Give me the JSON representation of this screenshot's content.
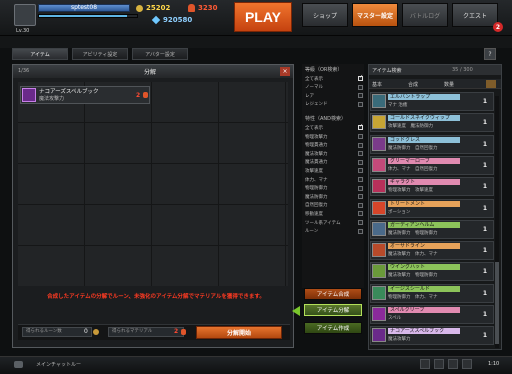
{
  "header": {
    "username": "sptest08",
    "level": "Lv.30",
    "gold": "25202",
    "fire": "3230",
    "gems": "920580",
    "exp_fraction": 0.9,
    "play_label": "PLAY",
    "nav": [
      {
        "label": "ショップ"
      },
      {
        "label": "マスター設定"
      },
      {
        "label": "バトルログ"
      },
      {
        "label": "クエスト"
      }
    ],
    "quest_badge": "2",
    "accent": "#e9661f"
  },
  "tabs": [
    {
      "label": "アイテム"
    },
    {
      "label": "アビリティ設定"
    },
    {
      "label": "アバター設定"
    }
  ],
  "help_label": "?",
  "panel": {
    "count": "1/36",
    "title": "分解",
    "close_label": "×",
    "slot": {
      "name": "ナコアーズスペルブック",
      "desc": "魔法攻撃力",
      "qty": "2"
    },
    "notice": "合成したアイテムの分解でルーン、未強化のアイテム分解でマテリアルを獲得できます。",
    "rune_label": "得られるルーン数",
    "rune_value": "0",
    "material_label": "得られるマテリアル",
    "material_value": "2",
    "decompose_label": "分解開始"
  },
  "filters": {
    "rarity_title": "等級（OR検索）",
    "rarity": [
      {
        "label": "全て表示",
        "checked": true
      },
      {
        "label": "ノーマル",
        "checked": false
      },
      {
        "label": "レア",
        "checked": false
      },
      {
        "label": "レジェンド",
        "checked": false
      }
    ],
    "attr_title": "特性（AND検索）",
    "attrs": [
      {
        "label": "全て表示",
        "checked": true
      },
      {
        "label": "物理攻撃力",
        "checked": false
      },
      {
        "label": "物理貫通力",
        "checked": false
      },
      {
        "label": "魔法攻撃力",
        "checked": false
      },
      {
        "label": "魔法貫通力",
        "checked": false
      },
      {
        "label": "攻撃速度",
        "checked": false
      },
      {
        "label": "体力、マナ",
        "checked": false
      },
      {
        "label": "物理防御力",
        "checked": false
      },
      {
        "label": "魔法防御力",
        "checked": false
      },
      {
        "label": "自然回復力",
        "checked": false
      },
      {
        "label": "移動速度",
        "checked": false
      },
      {
        "label": "ツール系アイテム",
        "checked": false
      },
      {
        "label": "ルーン",
        "checked": false
      }
    ]
  },
  "modes": {
    "synth": "アイテム合成",
    "decomp": "アイテム分解",
    "craft": "アイテム作成"
  },
  "item_list": {
    "title": "アイテム検索",
    "count": "35 / 300",
    "sort": {
      "basic": "基本",
      "combine": "合成",
      "qty": "数量"
    },
    "items": [
      {
        "name": "エルバントラップ",
        "tags": "マナ 治癒",
        "qty": "1",
        "color": "#3a6b7a",
        "bg": "#8dc0d8"
      },
      {
        "name": "ゴールドスネイクウィップ",
        "tags": "攻撃速度　魔法防御力",
        "qty": "1",
        "color": "#c7a534",
        "bg": "#8dc0d8"
      },
      {
        "name": "ゴッドクレス",
        "tags": "魔法防御力　自然回復力",
        "qty": "1",
        "color": "#7a3b8a",
        "bg": "#8dc0d8"
      },
      {
        "name": "グリーマーローブ",
        "tags": "体力、マナ　自然回復力",
        "qty": "1",
        "color": "#c34a7a",
        "bg": "#e08ab0"
      },
      {
        "name": "ギャラクト",
        "tags": "物理攻撃力　攻撃速度",
        "qty": "1",
        "color": "#b8305a",
        "bg": "#e08ab0"
      },
      {
        "name": "トリートメント",
        "tags": "ポーション",
        "qty": "1",
        "color": "#d6452a",
        "bg": "#e6a25a"
      },
      {
        "name": "ガーディアンヘルム",
        "tags": "魔法防御力　物理防御力",
        "qty": "1",
        "color": "#4a6a8a",
        "bg": "#8cc35a"
      },
      {
        "name": "オーサドライン",
        "tags": "魔法攻撃力　体力、マナ",
        "qty": "1",
        "color": "#b84a2a",
        "bg": "#e6a25a"
      },
      {
        "name": "ウイングハット",
        "tags": "魔法攻撃力　物理防御力",
        "qty": "1",
        "color": "#6a9a3a",
        "bg": "#8cc35a"
      },
      {
        "name": "イージスシールド",
        "tags": "物理防御力　体力、マナ",
        "qty": "1",
        "color": "#3a8a5a",
        "bg": "#8cc35a"
      },
      {
        "name": "スペルクリーブ",
        "tags": "スペル",
        "qty": "1",
        "color": "#8a2a9a",
        "bg": "#e08ab0"
      },
      {
        "name": "ナコアーズスペルブック",
        "tags": "魔法攻撃力",
        "qty": "1",
        "color": "#6a2a8a",
        "bg": "#d8b8ea"
      }
    ]
  },
  "bottom": {
    "chat_label": "メインチャットルー",
    "clock": "1:10"
  }
}
